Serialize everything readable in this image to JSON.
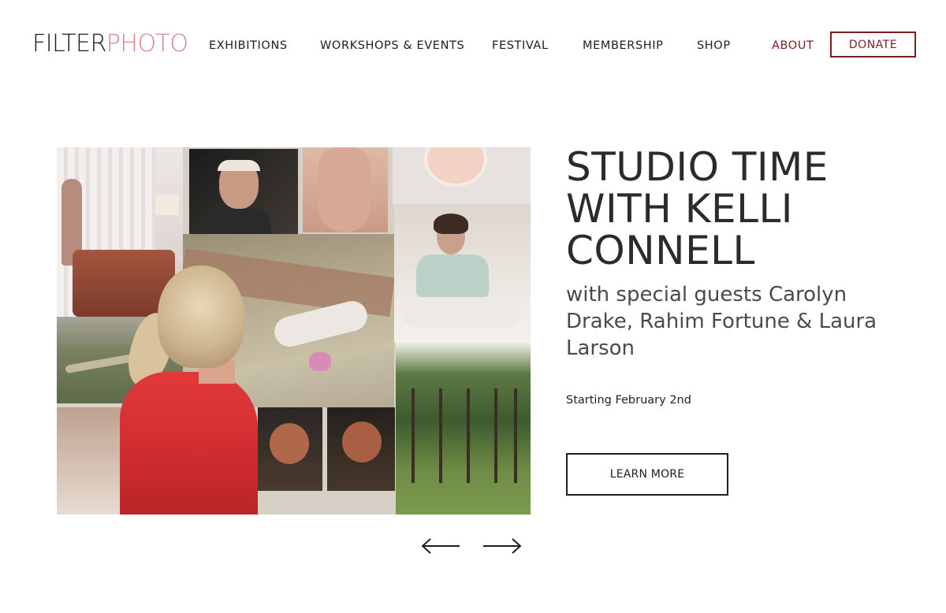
{
  "header": {
    "logo": {
      "part1": "FILTER",
      "part2": "PHOTO"
    },
    "nav": [
      {
        "label": "EXHIBITIONS"
      },
      {
        "label": "WORKSHOPS & EVENTS"
      },
      {
        "label": "FESTIVAL"
      },
      {
        "label": "MEMBERSHIP"
      },
      {
        "label": "SHOP"
      },
      {
        "label": "ABOUT"
      }
    ],
    "donate_label": "DONATE"
  },
  "slide": {
    "title": "STUDIO TIME WITH KELLI CONNELL",
    "subtitle": "with special guests Carolyn Drake, Rahim Fortune & Laura Larson",
    "date": "Starting February 2nd",
    "cta_label": "LEARN MORE"
  },
  "colors": {
    "accent": "#7a1e24",
    "logo_secondary": "#d9838a",
    "text": "#2b2b2b"
  },
  "icons": {
    "prev": "arrow-left-icon",
    "next": "arrow-right-icon"
  }
}
